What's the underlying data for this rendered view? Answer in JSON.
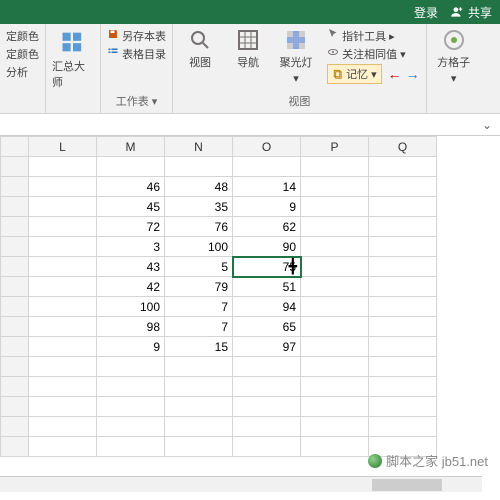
{
  "topbar": {
    "login": "登录",
    "share": "共享"
  },
  "ribbon": {
    "g1": {
      "i1": "定颜色",
      "i2": "定颜色",
      "i3": "分析"
    },
    "g2": {
      "label": "汇总大师"
    },
    "g3": {
      "i1": "另存本表",
      "i2": "表格目录",
      "label": "工作表"
    },
    "g4": {
      "b1": "视图",
      "b2": "导航",
      "b3": "聚光灯",
      "label": "视图"
    },
    "g5": {
      "i1": "指针工具",
      "i2": "关注相同值",
      "i3": "记忆"
    },
    "g6": {
      "label": "方格子"
    }
  },
  "columns": [
    "L",
    "M",
    "N",
    "O",
    "P",
    "Q"
  ],
  "data": {
    "M": [
      46,
      45,
      72,
      3,
      43,
      42,
      100,
      98,
      9
    ],
    "N": [
      48,
      35,
      76,
      100,
      5,
      79,
      7,
      7,
      15
    ],
    "O": [
      14,
      9,
      62,
      90,
      "",
      51,
      94,
      65,
      97
    ]
  },
  "selected_cell_value": "75",
  "watermark": "脚本之家 jb51.net"
}
